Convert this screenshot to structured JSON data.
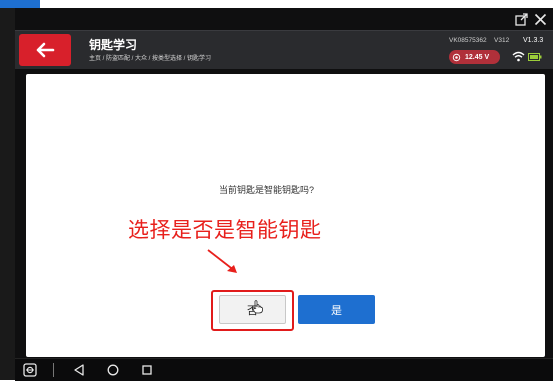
{
  "window": {
    "external_icon": "external-link-icon",
    "close_icon": "close-icon"
  },
  "header": {
    "title": "钥匙学习",
    "breadcrumb": "主页 / 防盗匹配 / 大众 / 按类型选择 / 钥匙学习",
    "vin": "VK08575362",
    "version": "V312",
    "app_version": "V1.3.3",
    "voltage": "12.45 V"
  },
  "dialog": {
    "question": "当前钥匙是智能钥匙吗?",
    "no_label": "否",
    "yes_label": "是"
  },
  "annotation": {
    "text": "选择是否是智能钥匙"
  },
  "colors": {
    "accent_red": "#d8202b",
    "primary_blue": "#1e6fd0",
    "annotation_red": "#e8201c"
  }
}
